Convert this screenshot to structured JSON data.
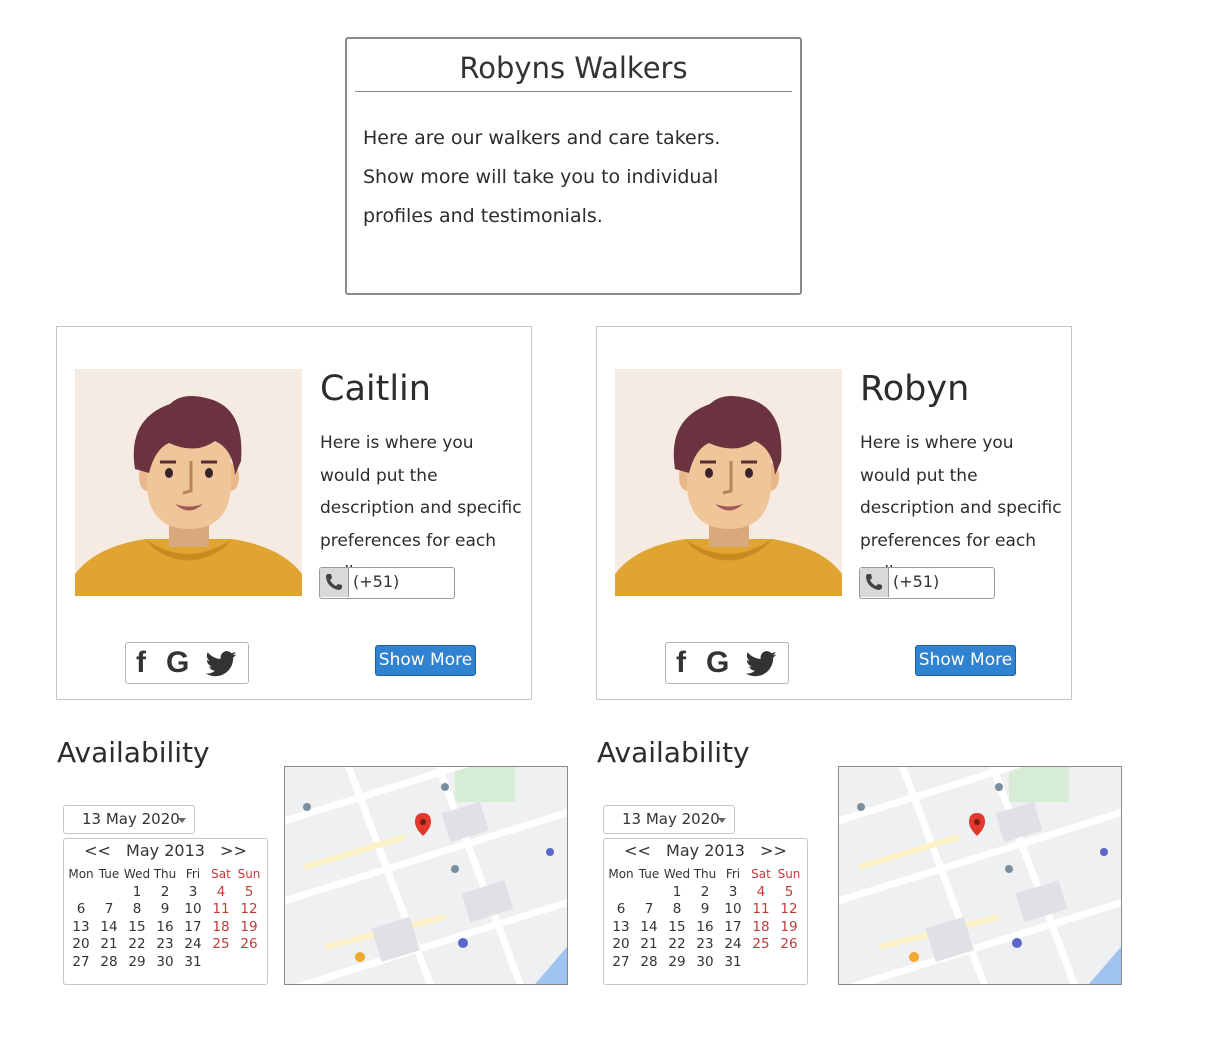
{
  "header": {
    "title": "Robyns Walkers",
    "description": "Here are our walkers and care takers. Show more will take you to individual profiles and testimonials."
  },
  "walkers": [
    {
      "name": "Caitlin",
      "description": "Here is where you would put the description and specific preferences for each walker",
      "phone": "(+51)",
      "show_more_label": "Show More",
      "social": {
        "facebook": "f",
        "google": "G"
      }
    },
    {
      "name": "Robyn",
      "description": "Here is where you would put the description and specific preferences for each walker",
      "phone": "(+51)",
      "show_more_label": "Show More",
      "social": {
        "facebook": "f",
        "google": "G"
      }
    }
  ],
  "availability": {
    "title": "Availability",
    "selected_date": "13 May 2020",
    "calendar": {
      "prev": "<<",
      "month_label": "May 2013",
      "next": ">>",
      "day_names": [
        "Mon",
        "Tue",
        "Wed",
        "Thu",
        "Fri",
        "Sat",
        "Sun"
      ],
      "weeks": [
        [
          "",
          "",
          "1",
          "2",
          "3",
          "4",
          "5"
        ],
        [
          "6",
          "7",
          "8",
          "9",
          "10",
          "11",
          "12"
        ],
        [
          "13",
          "14",
          "15",
          "16",
          "17",
          "18",
          "19"
        ],
        [
          "20",
          "21",
          "22",
          "23",
          "24",
          "25",
          "26"
        ],
        [
          "27",
          "28",
          "29",
          "30",
          "31",
          "",
          ""
        ]
      ]
    }
  },
  "colors": {
    "button_bg": "#2f83d0",
    "weekend": "#c23a3a",
    "avatar_bg": "#f5ebe3",
    "shirt": "#e0a431",
    "hair": "#6b3340",
    "skin": "#efc59a"
  },
  "icons": [
    "phone-icon",
    "facebook-icon",
    "google-icon",
    "twitter-icon",
    "map-pin-icon",
    "dropdown-caret-icon"
  ]
}
